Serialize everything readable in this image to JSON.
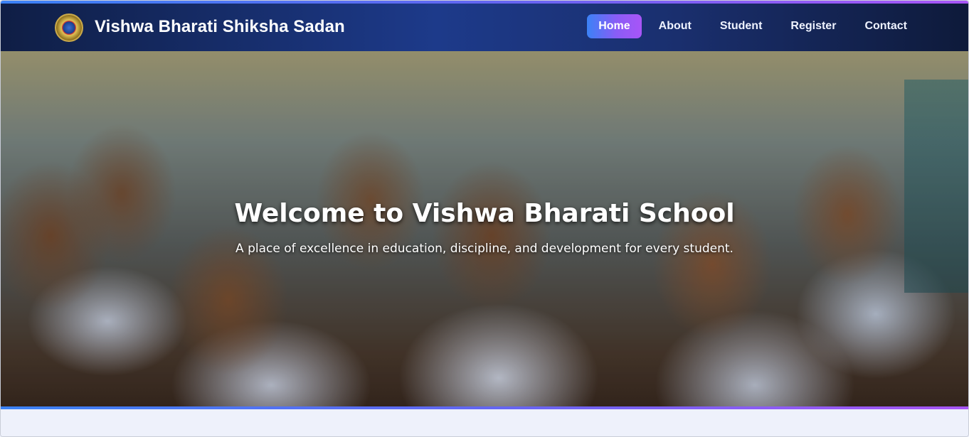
{
  "colors": {
    "accent_start": "#3b82f6",
    "accent_end": "#a855f7",
    "navbar_bg": "#1d3a8a",
    "page_bg": "#eef1fb"
  },
  "header": {
    "logo_icon": "school-crest-icon",
    "brand": "Vishwa Bharati Shiksha Sadan",
    "nav": [
      {
        "label": "Home",
        "active": true
      },
      {
        "label": "About",
        "active": false
      },
      {
        "label": "Student",
        "active": false
      },
      {
        "label": "Register",
        "active": false
      },
      {
        "label": "Contact",
        "active": false
      }
    ]
  },
  "hero": {
    "title": "Welcome to Vishwa Bharati School",
    "subtitle": "A place of excellence in education, discipline, and development for every student."
  }
}
